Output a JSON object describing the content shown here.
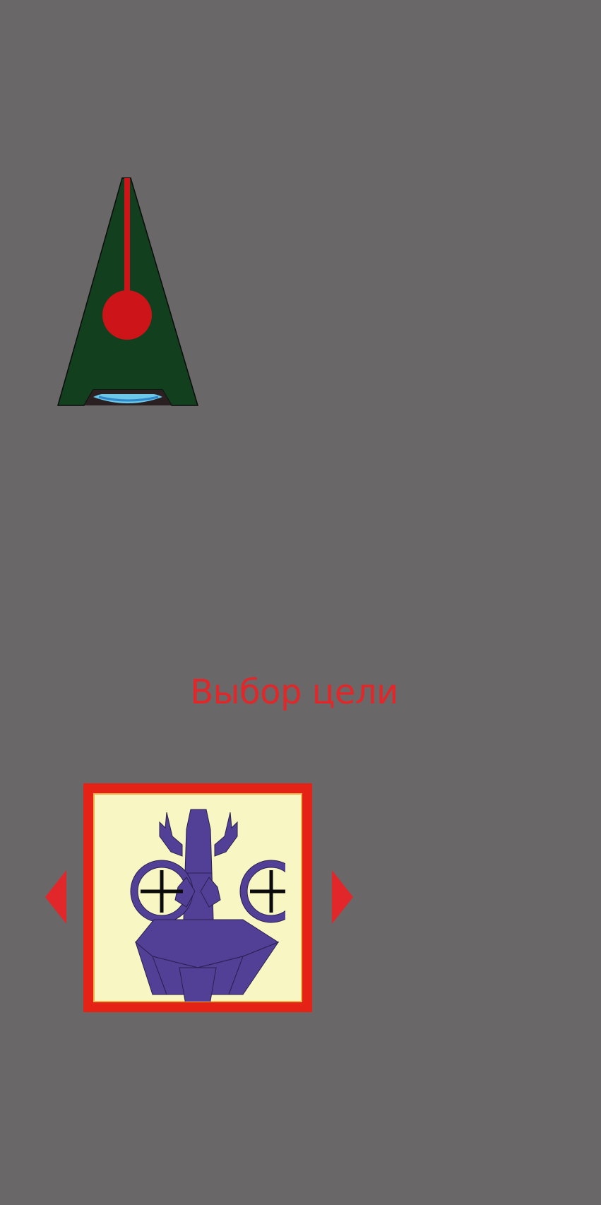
{
  "title": "Выбор цели",
  "colors": {
    "background": "#696768",
    "accent": "#e42316",
    "title_text": "#e0272a",
    "card_fill": "#f8f6c2",
    "ship_hull": "#123f1e",
    "ship_core": "#cd1419",
    "target_body": "#523f96",
    "arrow": "#e2272a"
  },
  "player_ship": {
    "icon": "player-ship-icon"
  },
  "selector": {
    "prev": {
      "icon": "arrow-left-icon"
    },
    "next": {
      "icon": "arrow-right-icon"
    },
    "current_target": {
      "icon": "enemy-robot-icon"
    }
  }
}
